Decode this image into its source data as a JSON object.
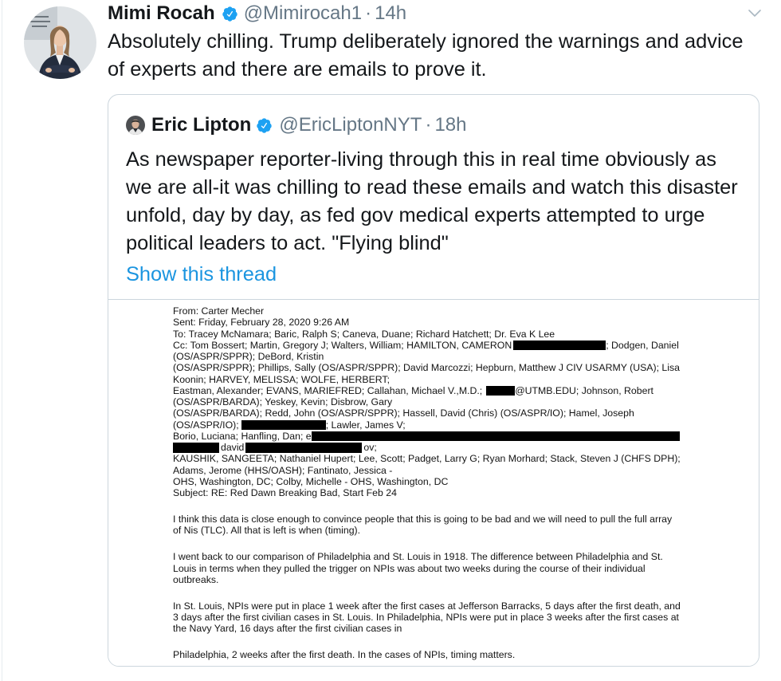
{
  "colors": {
    "text": "#14171a",
    "muted": "#657786",
    "verified": "#1da1f2",
    "link": "#1b95e0",
    "border": "#ccd6dd",
    "redaction": "#000000"
  },
  "icons": {
    "verified": "verified-badge-icon",
    "more_menu": "chevron-down-icon"
  },
  "tweet": {
    "author_name": "Mimi Rocah",
    "handle": "@Mimirocah1",
    "separator": "·",
    "time": "14h",
    "text_lines": [
      "Absolutely chilling. Trump deliberately ignored the warnings and advice",
      "of experts and there are emails to prove it."
    ]
  },
  "quoted_tweet": {
    "author_name": "Eric Lipton",
    "handle": "@EricLiptonNYT",
    "separator": "·",
    "time": "18h",
    "text_lines": [
      "As newspaper reporter-living through this in real time obviously as",
      "we are all-it was chilling to read these emails and watch this disaster",
      "unfold, day by day, as fed gov medical experts attempted to urge",
      "political leaders to act. \"Flying blind\""
    ],
    "show_thread": "Show this thread"
  },
  "email": {
    "header": [
      "From: Carter Mecher",
      "Sent: Friday, February 28, 2020 9:26 AM",
      "To: Tracey McNamara; Baric, Ralph S; Caneva, Duane; Richard Hatchett; Dr. Eva K Lee",
      {
        "before": "Cc: Tom Bossert; Martin, Gregory J; Walters, William; HAMILTON, CAMERON",
        "after": "; Dodgen, Daniel"
      },
      "(OS/ASPR/SPPR); DeBord, Kristin",
      "(OS/ASPR/SPPR); Phillips, Sally (OS/ASPR/SPPR); David Marcozzi; Hepburn, Matthew J CIV USARMY (USA); Lisa",
      "Koonin; HARVEY, MELISSA; WOLFE, HERBERT;",
      {
        "before": "Eastman, Alexander; EVANS, MARIEFRED; Callahan, Michael V.,M.D.;",
        "after": "@UTMB.EDU; Johnson, Robert"
      },
      "(OS/ASPR/BARDA); Yeskey, Kevin; Disbrow, Gary",
      "(OS/ASPR/BARDA); Redd, John (OS/ASPR/SPPR); Hassell, David (Chris) (OS/ASPR/IO); Hamel, Joseph",
      {
        "before": "(OS/ASPR/IO);",
        "after": "; Lawler, James V;"
      },
      {
        "before": "Borio, Luciana; Hanfling, Dan; e"
      },
      {
        "middle": "david",
        "after": "ov;"
      },
      "KAUSHIK, SANGEETA; Nathaniel Hupert; Lee, Scott; Padget, Larry G; Ryan Morhard; Stack, Steven J (CHFS DPH);",
      "Adams, Jerome (HHS/OASH); Fantinato, Jessica -",
      "OHS, Washington, DC; Colby, Michelle - OHS, Washington, DC",
      "Subject: RE: Red Dawn Breaking Bad, Start Feb 24"
    ],
    "body": [
      [
        "I think this data is close enough to convince people that this is going to be bad and we will need to pull the full array",
        "of Nis (TLC). All that is left is when (timing)."
      ],
      [
        "I went back to our comparison of Philadelphia and St. Louis in 1918. The difference between Philadelphia and St.",
        "Louis in terms when they pulled the trigger on NPIs was about two weeks during the course of their individual",
        "outbreaks."
      ],
      [
        "In St. Louis, NPIs were put in place 1 week after the first cases at Jefferson Barracks, 5 days after the first death, and",
        "3 days after the first civilian cases in St. Louis. In Philadelphia, NPIs were put in place 3 weeks after the first cases at",
        "the Navy Yard, 16 days after the first civilian cases in"
      ],
      [
        "Philadelphia, 2 weeks after the first death. In the cases of NPIs, timing matters."
      ]
    ]
  }
}
